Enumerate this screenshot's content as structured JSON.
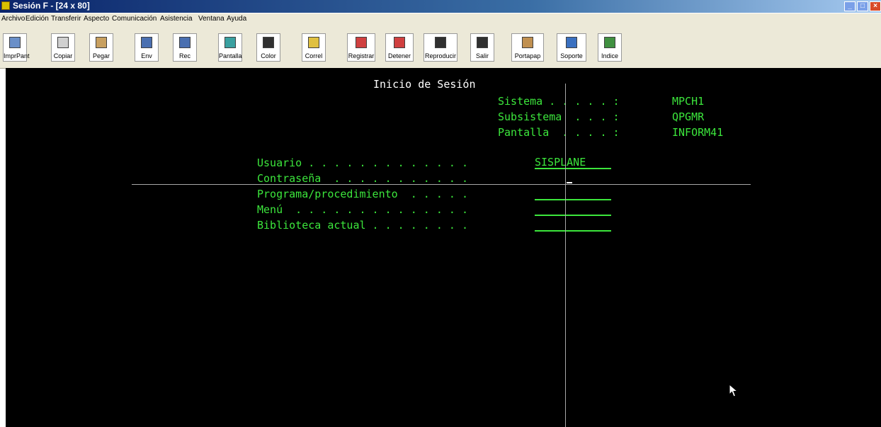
{
  "window": {
    "title": "Sesión F - [24 x 80]"
  },
  "menubar": [
    "Archivo",
    "Edición",
    "Transferir",
    "Aspecto",
    "Comunicación",
    "Asistencia",
    "Ventana",
    "Ayuda"
  ],
  "toolbar": [
    {
      "label": "ImprPant",
      "icon": "print-screen-icon",
      "color": "#6a8fc8"
    },
    {
      "label": "Copiar",
      "icon": "copy-icon",
      "color": "#d0d0d0"
    },
    {
      "label": "Pegar",
      "icon": "paste-icon",
      "color": "#c8a060"
    },
    {
      "label": "Env",
      "icon": "send-icon",
      "color": "#4a6fb0"
    },
    {
      "label": "Rec",
      "icon": "receive-icon",
      "color": "#4a6fb0"
    },
    {
      "label": "Pantalla",
      "icon": "display-icon",
      "color": "#3aa0a0"
    },
    {
      "label": "Color",
      "icon": "color-icon",
      "color": "#303030"
    },
    {
      "label": "Correl",
      "icon": "edit-icon",
      "color": "#e0c040"
    },
    {
      "label": "Registrar",
      "icon": "record-icon",
      "color": "#d04040"
    },
    {
      "label": "Detener",
      "icon": "stop-icon",
      "color": "#d04040"
    },
    {
      "label": "Reproducir",
      "icon": "play-icon",
      "color": "#303030"
    },
    {
      "label": "Salir",
      "icon": "exit-icon",
      "color": "#303030"
    },
    {
      "label": "Portapap",
      "icon": "clipboard-icon",
      "color": "#c09050"
    },
    {
      "label": "Soporte",
      "icon": "globe-icon",
      "color": "#3a70c0"
    },
    {
      "label": "Indice",
      "icon": "help-index-icon",
      "color": "#409040"
    }
  ],
  "terminal": {
    "title": "Inicio de Sesión",
    "info": [
      {
        "label": "Sistema . . . . . :",
        "value": "MPCH1"
      },
      {
        "label": "Subsistema  . . . :",
        "value": "QPGMR"
      },
      {
        "label": "Pantalla  . . . . :",
        "value": "INFORM41"
      }
    ],
    "fields": [
      {
        "label": "Usuario . . . . . . . . . . . . .",
        "value": "SISPLANE"
      },
      {
        "label": "Contraseña  . . . . . . . . . . .",
        "value": ""
      },
      {
        "label": "Programa/procedimiento  . . . . .",
        "value": ""
      },
      {
        "label": "Menú  . . . . . . . . . . . . . .",
        "value": ""
      },
      {
        "label": "Biblioteca actual . . . . . . . .",
        "value": ""
      }
    ]
  }
}
